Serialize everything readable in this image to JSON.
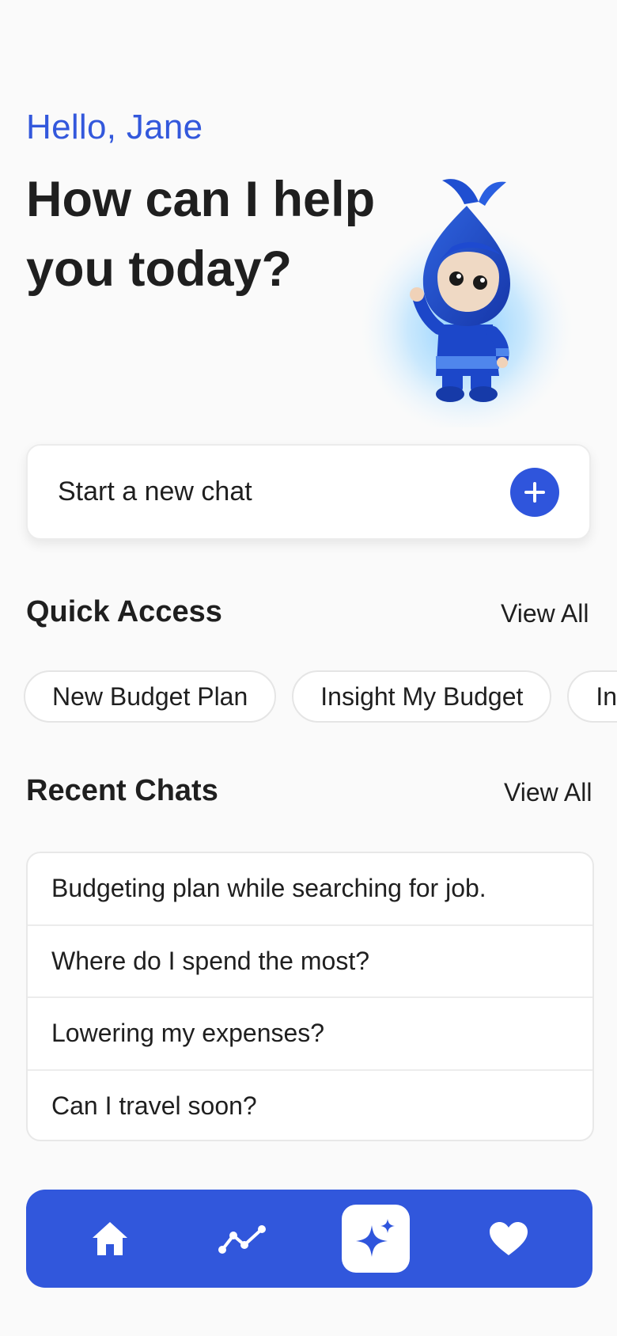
{
  "header": {
    "greeting": "Hello, Jane",
    "headline": "How can I help you today?"
  },
  "new_chat": {
    "label": "Start a new chat"
  },
  "quick_access": {
    "title": "Quick Access",
    "view_all": "View All",
    "chips": [
      "New Budget Plan",
      "Insight My Budget",
      "In"
    ]
  },
  "recent_chats": {
    "title": "Recent Chats",
    "view_all": "View All",
    "items": [
      "Budgeting plan while searching for job.",
      "Where do I spend the most?",
      "Lowering my expenses?",
      "Can I travel soon?"
    ]
  },
  "nav": {
    "items": [
      {
        "icon": "home-icon",
        "active": false
      },
      {
        "icon": "trend-chart-icon",
        "active": false
      },
      {
        "icon": "sparkle-ai-icon",
        "active": true
      },
      {
        "icon": "heart-icon",
        "active": false
      }
    ]
  },
  "colors": {
    "accent": "#3358dc",
    "nav_bg": "#3157dc",
    "background": "#fafafa",
    "text": "#1f1f1f"
  }
}
